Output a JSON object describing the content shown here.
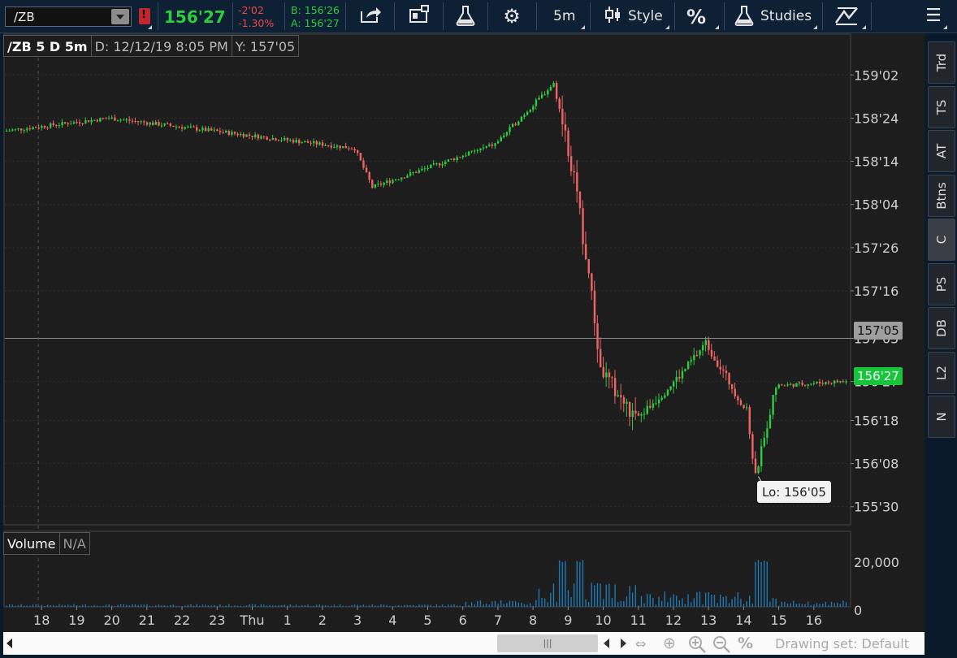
{
  "toolbar": {
    "symbol": "/ZB",
    "alert_badge": "!",
    "last_price": "156'27",
    "net_change": "-2'02",
    "net_change_pct": "-1.30%",
    "bid": "B: 156'26",
    "ask": "A: 156'27",
    "timeframe": "5m",
    "style_label": "Style",
    "percent_label": "%",
    "studies_label": "Studies"
  },
  "chart": {
    "header": {
      "symbol_period": "/ZB 5 D 5m",
      "date": "D: 12/12/19 8:05 PM",
      "y_value": "Y: 157'05"
    },
    "price_axis": [
      "159'02",
      "158'24",
      "158'14",
      "158'04",
      "157'26",
      "157'16",
      "157'05",
      "156'27",
      "156'18",
      "156'08",
      "155'30"
    ],
    "cursor_price": "157'05",
    "last_price_tag": "156'27",
    "low_label": "Lo: 156'05",
    "volume_label": "Volume",
    "volume_value": "N/A",
    "volume_axis": [
      "20,000",
      "0"
    ],
    "time_axis": [
      "18",
      "19",
      "20",
      "21",
      "22",
      "23",
      "Thu",
      "1",
      "2",
      "3",
      "4",
      "5",
      "6",
      "7",
      "8",
      "9",
      "10",
      "11",
      "12",
      "13",
      "14",
      "15",
      "16"
    ]
  },
  "chart_data": {
    "type": "candlestick",
    "title": "/ZB 5 D 5m",
    "price_unit": "32nds",
    "ylim": [
      "155'26",
      "159'06"
    ],
    "grid": true,
    "colors": {
      "up": "#2ecc40",
      "down": "#f06464",
      "volume": "#1e78b4",
      "last_price": "#17c53b"
    },
    "last_price": "156'27",
    "low": "156'05",
    "cursor_y": "157'05",
    "key_points": [
      {
        "x": "17:00",
        "price": "158'21"
      },
      {
        "x": "20:00",
        "price": "158'24"
      },
      {
        "x": "3:00",
        "price": "158'17"
      },
      {
        "x": "3:30",
        "price": "158'08"
      },
      {
        "x": "7:00",
        "price": "158'18"
      },
      {
        "x": "8:40",
        "price": "159'00"
      },
      {
        "x": "9:15",
        "price": "158'10"
      },
      {
        "x": "9:40",
        "price": "157'20"
      },
      {
        "x": "10:00",
        "price": "156'30"
      },
      {
        "x": "11:00",
        "price": "156'18"
      },
      {
        "x": "12:20",
        "price": "156'29"
      },
      {
        "x": "13:00",
        "price": "157'04"
      },
      {
        "x": "14:10",
        "price": "156'20"
      },
      {
        "x": "14:25",
        "price": "156'05"
      },
      {
        "x": "15:00",
        "price": "156'26"
      },
      {
        "x": "16:50",
        "price": "156'27"
      }
    ]
  },
  "side_panel": {
    "tabs": [
      "Trd",
      "TS",
      "AT",
      "Btns",
      "C",
      "PS",
      "DB",
      "L2",
      "N"
    ],
    "active": "C"
  },
  "bottom_bar": {
    "drawing_set": "Drawing set: Default",
    "scroll_grip": "|||"
  }
}
